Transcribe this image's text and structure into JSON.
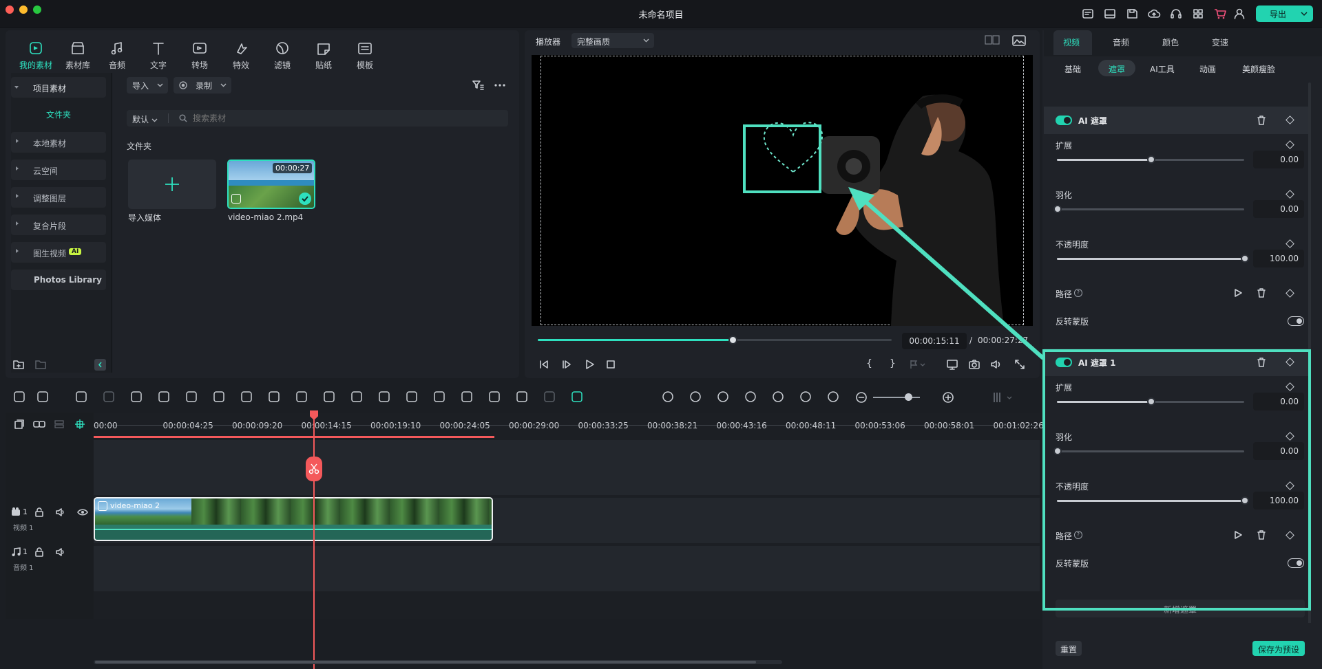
{
  "window": {
    "title": "未命名项目"
  },
  "header": {
    "export_label": "导出"
  },
  "media_tabs": [
    {
      "label": "我的素材",
      "icon": "my-media-icon",
      "active": true
    },
    {
      "label": "素材库",
      "icon": "stock-media-icon"
    },
    {
      "label": "音频",
      "icon": "audio-icon"
    },
    {
      "label": "文字",
      "icon": "text-icon"
    },
    {
      "label": "转场",
      "icon": "transition-icon"
    },
    {
      "label": "特效",
      "icon": "effects-icon"
    },
    {
      "label": "滤镜",
      "icon": "filter-icon"
    },
    {
      "label": "贴纸",
      "icon": "sticker-icon"
    },
    {
      "label": "模板",
      "icon": "template-icon"
    }
  ],
  "sidebar": {
    "project_media": "项目素材",
    "folder": "文件夹",
    "items": [
      "本地素材",
      "云空间",
      "调整图层",
      "复合片段",
      "图生视频"
    ],
    "ai_badge": "AI",
    "photos_library": "Photos Library"
  },
  "media_panel": {
    "import_label": "导入",
    "record_label": "录制",
    "sort_label": "默认",
    "search_placeholder": "搜索素材",
    "folder_title": "文件夹",
    "import_media_label": "导入媒体",
    "clip": {
      "name": "video-miao 2.mp4",
      "duration": "00:00:27"
    }
  },
  "player": {
    "label": "播放器",
    "quality": "完整画质",
    "current_time": "00:00:15:11",
    "separator": "/",
    "total_time": "00:00:27:27",
    "progress": 0.55
  },
  "inspector": {
    "tabs": [
      "视频",
      "音频",
      "颜色",
      "变速"
    ],
    "active_tab": "视频",
    "subtabs": [
      "基础",
      "遮罩",
      "AI工具",
      "动画",
      "美颜瘦脸"
    ],
    "active_subtab": "遮罩",
    "mask1": {
      "title": "AI 遮罩",
      "expand_label": "扩展",
      "expand_value": "0.00",
      "feather_label": "羽化",
      "feather_value": "0.00",
      "opacity_label": "不透明度",
      "opacity_value": "100.00",
      "path_label": "路径",
      "invert_label": "反转蒙版"
    },
    "mask2": {
      "title": "AI 遮罩 1",
      "expand_label": "扩展",
      "expand_value": "0.00",
      "feather_label": "羽化",
      "feather_value": "0.00",
      "opacity_label": "不透明度",
      "opacity_value": "100.00",
      "path_label": "路径",
      "invert_label": "反转蒙版"
    },
    "add_mask_label": "新增遮罩",
    "reset_label": "重置",
    "save_preset_label": "保存为预设"
  },
  "timeline": {
    "ruler": [
      "00:00",
      "00:00:04:25",
      "00:00:09:20",
      "00:00:14:15",
      "00:00:19:10",
      "00:00:24:05",
      "00:00:29:00",
      "00:00:33:25",
      "00:00:38:21",
      "00:00:43:16",
      "00:00:48:11",
      "00:00:53:06",
      "00:00:58:01",
      "00:01:02:26"
    ],
    "clip_name": "video-miao 2",
    "video_track": {
      "num": "1",
      "name": "视频 1"
    },
    "audio_track": {
      "num": "1",
      "name": "音频 1"
    }
  },
  "colors": {
    "accent": "#22d3b0",
    "playhead": "#f4595b",
    "annotation": "#4fe0c0"
  }
}
